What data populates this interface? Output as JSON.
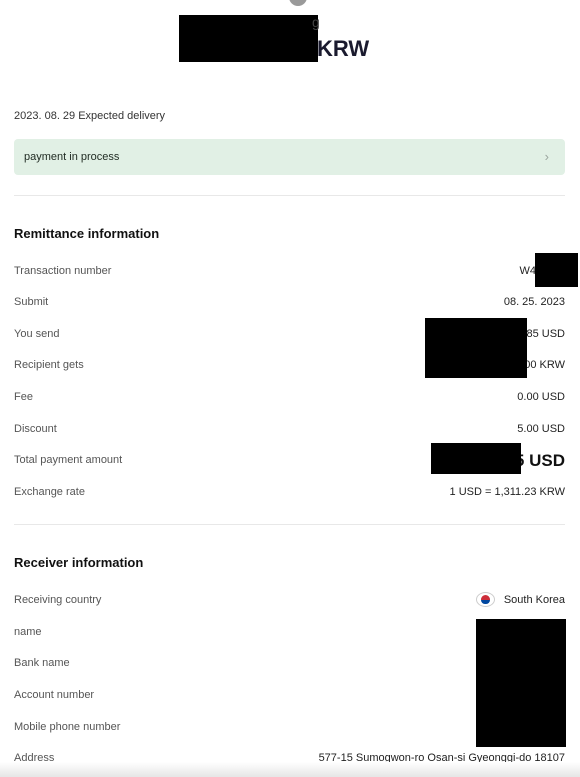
{
  "header": {
    "amount_partial_glyph": "g",
    "amount_currency": "KRW"
  },
  "delivery": {
    "text": "2023. 08. 29 Expected delivery"
  },
  "status": {
    "label": "payment in process",
    "chevron": "›"
  },
  "remittance": {
    "title": "Remittance information",
    "rows": [
      {
        "label": "Transaction number",
        "value": "W4"
      },
      {
        "label": "Submit",
        "value": "08. 25. 2023"
      },
      {
        "label": "You send",
        "value": "85 USD"
      },
      {
        "label": "Recipient gets",
        "value": "00 KRW"
      },
      {
        "label": "Fee",
        "value": "0.00 USD"
      },
      {
        "label": "Discount",
        "value": "5.00 USD"
      },
      {
        "label": "Total payment amount",
        "value": "5 USD"
      },
      {
        "label": "Exchange rate",
        "value": "1 USD = 1,311.23 KRW"
      }
    ]
  },
  "receiver": {
    "title": "Receiver information",
    "rows": [
      {
        "label": "Receiving country",
        "value": "South Korea",
        "icon": "south-korea-flag-icon"
      },
      {
        "label": "name",
        "value": ""
      },
      {
        "label": "Bank name",
        "value": ""
      },
      {
        "label": "Account number",
        "value": ""
      },
      {
        "label": "Mobile phone number",
        "value": ""
      },
      {
        "label": "Address",
        "value": "577-15 Sumogwon-ro Osan-si Gyeonggi-do 18107"
      }
    ]
  },
  "colors": {
    "status_bg": "#e1f0e5",
    "redaction": "#000000"
  }
}
